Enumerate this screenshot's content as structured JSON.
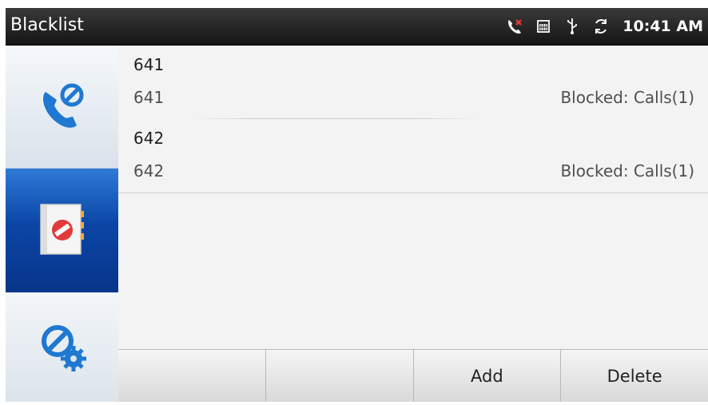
{
  "statusbar": {
    "title": "Blacklist",
    "time": "10:41 AM",
    "icons": [
      "missed-call-icon",
      "calendar-icon",
      "usb-icon",
      "sync-icon"
    ]
  },
  "sidebar": {
    "items": [
      {
        "icon": "blocked-call-icon",
        "selected": false
      },
      {
        "icon": "blocked-contacts-book-icon",
        "selected": true
      },
      {
        "icon": "block-settings-icon",
        "selected": false
      }
    ]
  },
  "list": {
    "rows": [
      {
        "name": "641",
        "number": "641",
        "status": "Blocked: Calls(1)"
      },
      {
        "name": "642",
        "number": "642",
        "status": "Blocked: Calls(1)"
      }
    ]
  },
  "softkeys": {
    "key1": "",
    "key2": "",
    "add": "Add",
    "delete": "Delete"
  },
  "colors": {
    "statusbar_bg": "#1e1e1e",
    "selected_nav": "#0b46a6",
    "list_bg": "#f3f3f3",
    "missed_call_red": "#e03a3a"
  }
}
